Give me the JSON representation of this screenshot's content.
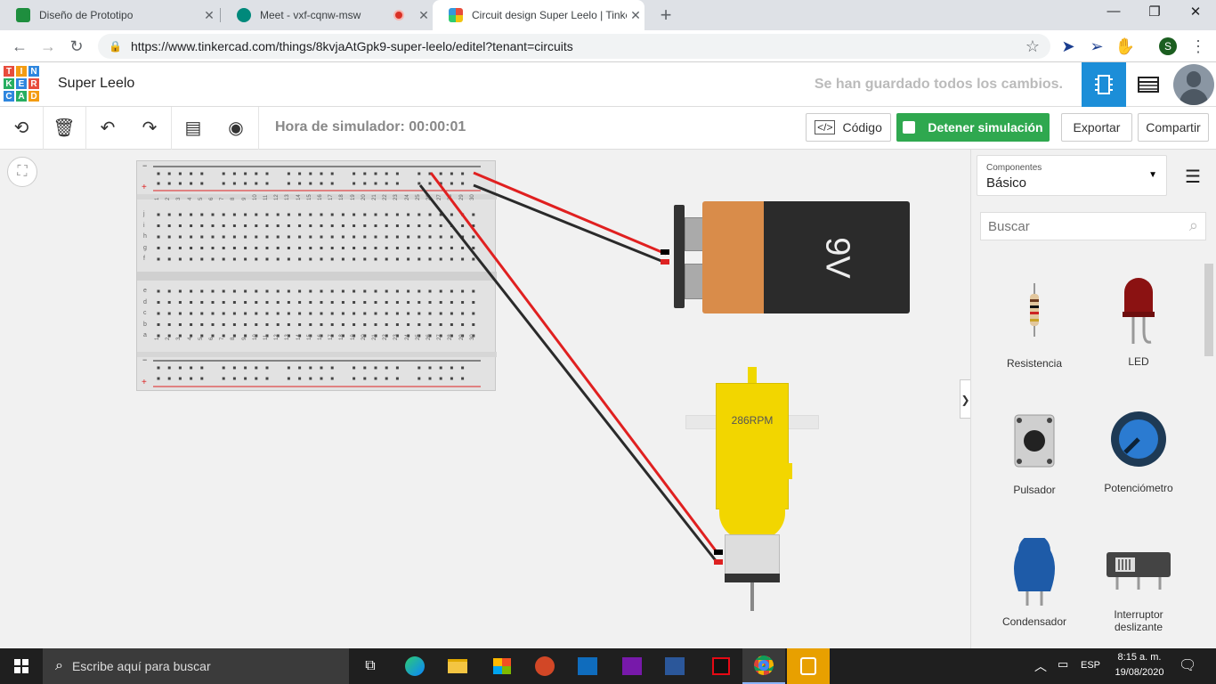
{
  "tabs": [
    {
      "title": "Diseño de Prototipo",
      "color": "#1e8e3e"
    },
    {
      "title": "Meet - vxf-cqnw-msw",
      "color": "#00897b"
    },
    {
      "title": "Circuit design Super Leelo | Tinke",
      "color": "#e0a000"
    }
  ],
  "new_tab": "+",
  "window": {
    "minimize": "—",
    "maximize": "❐",
    "close": "✕"
  },
  "url": "https://www.tinkercad.com/things/8kvjaAtGpk9-super-leelo/editel?tenant=circuits",
  "profile_initial": "S",
  "logo_letters": [
    "T",
    "I",
    "N",
    "K",
    "E",
    "R",
    "C",
    "A",
    "D"
  ],
  "app": {
    "project_name": "Super Leelo",
    "save_status": "Se han guardado todos los cambios."
  },
  "toolbar": {
    "sim_time": "Hora de simulador: 00:00:01",
    "code": "Código",
    "stop_sim": "Detener simulación",
    "export": "Exportar",
    "share": "Compartir"
  },
  "panel": {
    "dropdown_label": "Componentes",
    "dropdown_value": "Básico",
    "search_placeholder": "Buscar",
    "components": [
      "Resistencia",
      "LED",
      "Pulsador",
      "Potenciómetro",
      "Condensador",
      "Interruptor deslizante"
    ]
  },
  "canvas": {
    "battery_label": "9V",
    "motor_label": "286RPM",
    "expand_arrow": "❯",
    "bb_cols_top": [
      "1",
      "2",
      "3",
      "4",
      "5",
      "6",
      "7",
      "8",
      "9",
      "10",
      "11",
      "12",
      "13",
      "14",
      "15",
      "16",
      "17",
      "18",
      "19",
      "20",
      "21",
      "22",
      "23",
      "24",
      "25",
      "26",
      "27",
      "28",
      "29",
      "30"
    ],
    "bb_rows_top": [
      "j",
      "i",
      "h",
      "g",
      "f"
    ],
    "bb_rows_bottom": [
      "e",
      "d",
      "c",
      "b",
      "a"
    ],
    "rail_minus": "−",
    "rail_plus": "+"
  },
  "taskbar": {
    "search_placeholder": "Escribe aquí para buscar",
    "lang": "ESP",
    "time": "8:15 a. m.",
    "date": "19/08/2020"
  }
}
